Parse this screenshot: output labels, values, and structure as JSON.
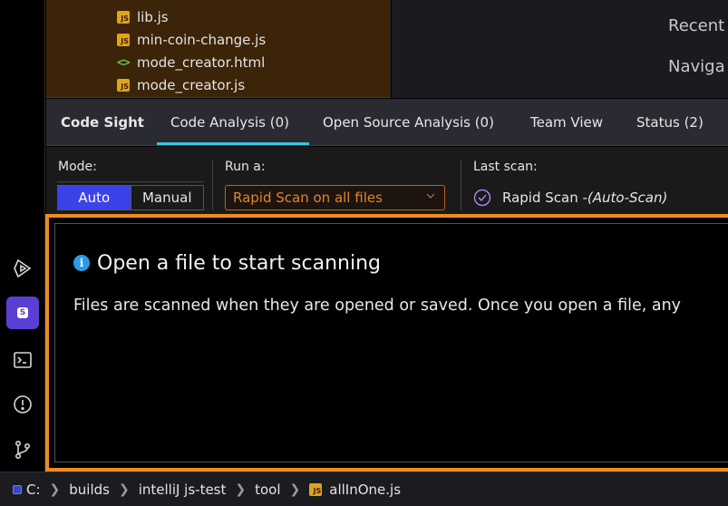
{
  "file_tree": {
    "items": [
      {
        "name": "lib.js",
        "type": "js"
      },
      {
        "name": "min-coin-change.js",
        "type": "js"
      },
      {
        "name": "mode_creator.html",
        "type": "html"
      },
      {
        "name": "mode_creator.js",
        "type": "js"
      }
    ]
  },
  "right_panel": {
    "recent_label": "Recent",
    "navigate_label": "Naviga"
  },
  "tabs": {
    "title": "Code Sight",
    "items": [
      {
        "label": "Code Analysis (0)",
        "active": true
      },
      {
        "label": "Open Source Analysis (0)",
        "active": false
      },
      {
        "label": "Team View",
        "active": false
      },
      {
        "label": "Status (2)",
        "active": false
      }
    ]
  },
  "controls": {
    "mode_label": "Mode:",
    "mode_auto": "Auto",
    "mode_manual": "Manual",
    "mode_selected": "Auto",
    "run_label": "Run a:",
    "run_value": "Rapid Scan on all files",
    "last_scan_label": "Last scan:",
    "last_scan_type": "Rapid Scan - ",
    "last_scan_mode": "(Auto-Scan)"
  },
  "main": {
    "title": "Open a file to start scanning",
    "description": "Files are scanned when they are opened or saved. Once you open a file, any"
  },
  "breadcrumb": {
    "items": [
      "C:",
      "builds",
      "intelliJ js-test",
      "tool",
      "allInOne.js"
    ]
  },
  "icons": {
    "activity": [
      "run-icon",
      "code-sight-icon",
      "terminal-icon",
      "problems-icon",
      "git-icon"
    ]
  },
  "colors": {
    "accent_orange": "#f08a24",
    "tab_underline": "#35c6e6",
    "mode_active": "#3a42e8",
    "plugin_purple": "#5b3fd4",
    "js_badge": "#e0a31a"
  }
}
